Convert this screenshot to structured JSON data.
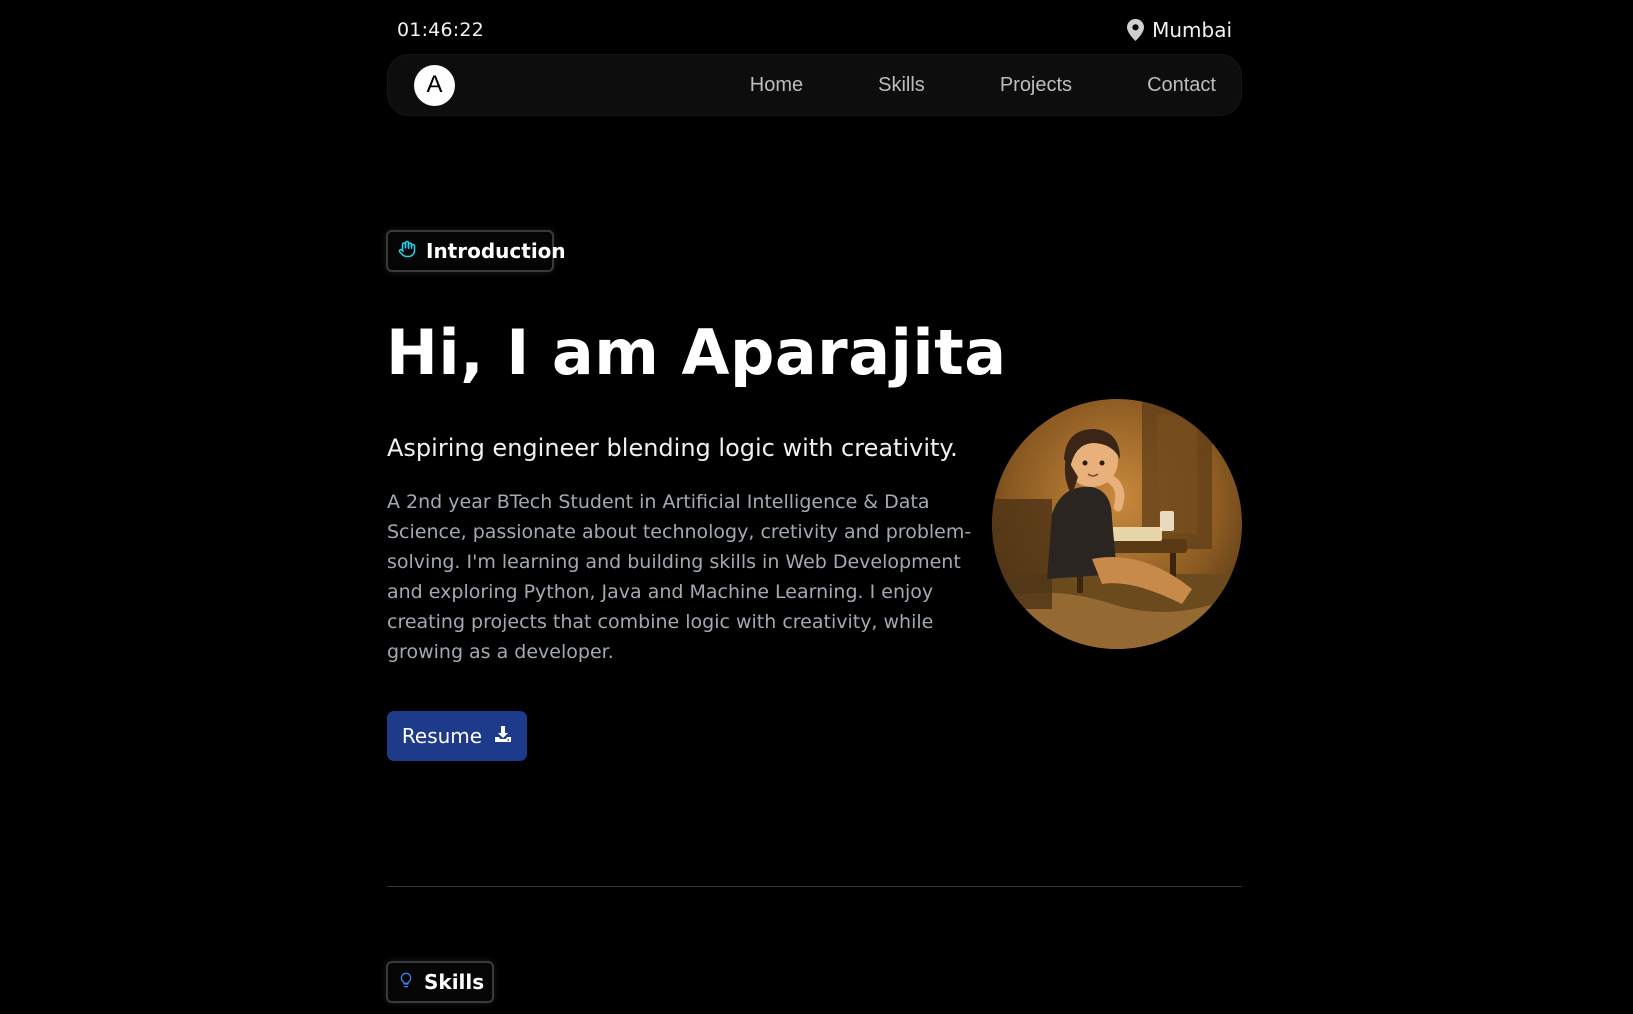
{
  "status": {
    "time": "01:46:22",
    "location": "Mumbai"
  },
  "nav": {
    "logo_letter": "A",
    "links": [
      "Home",
      "Skills",
      "Projects",
      "Contact"
    ]
  },
  "intro": {
    "badge_label": "Introduction",
    "title": "Hi, I am Aparajita",
    "subtitle": "Aspiring engineer blending logic with creativity.",
    "description": "A 2nd year BTech Student in Artificial Intelligence & Data Science, passionate about technology, cretivity and problem-solving. I'm learning and building skills in Web Development and exploring Python, Java and Machine Learning. I enjoy creating projects that combine logic with creativity, while growing as a developer.",
    "resume_label": "Resume"
  },
  "skills": {
    "badge_label": "Skills"
  },
  "icons": {
    "location": "map-pin-icon",
    "intro_badge": "hand-wave-icon",
    "resume": "download-icon",
    "skills_badge": "lightbulb-icon"
  },
  "colors": {
    "background": "#000000",
    "accent_button": "#1e3a8a",
    "intro_icon": "#22d3ee",
    "skills_icon": "#3b82f6"
  }
}
